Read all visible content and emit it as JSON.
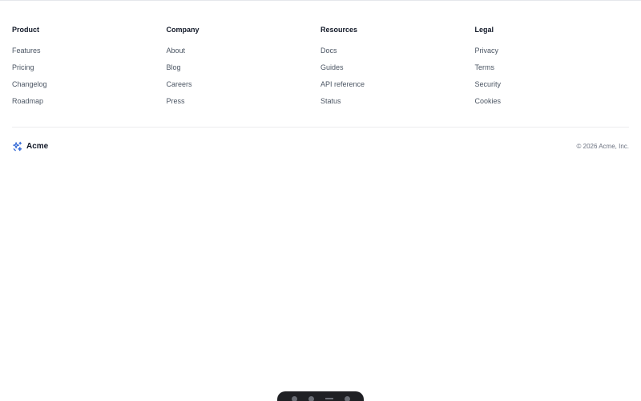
{
  "footer": {
    "columns": [
      {
        "heading": "Product",
        "links": [
          "Features",
          "Pricing",
          "Changelog",
          "Roadmap"
        ]
      },
      {
        "heading": "Company",
        "links": [
          "About",
          "Blog",
          "Careers",
          "Press"
        ]
      },
      {
        "heading": "Resources",
        "links": [
          "Docs",
          "Guides",
          "API reference",
          "Status"
        ]
      },
      {
        "heading": "Legal",
        "links": [
          "Privacy",
          "Terms",
          "Security",
          "Cookies"
        ]
      }
    ],
    "brand": {
      "name": "Acme",
      "icon": "sparkle-logo-icon",
      "color": "#3b6fd8"
    },
    "copyright": "© 2026 Acme, Inc."
  },
  "toolbar": {
    "icons": [
      "circle-icon",
      "circle-icon",
      "menu-icon",
      "circle-icon"
    ]
  }
}
